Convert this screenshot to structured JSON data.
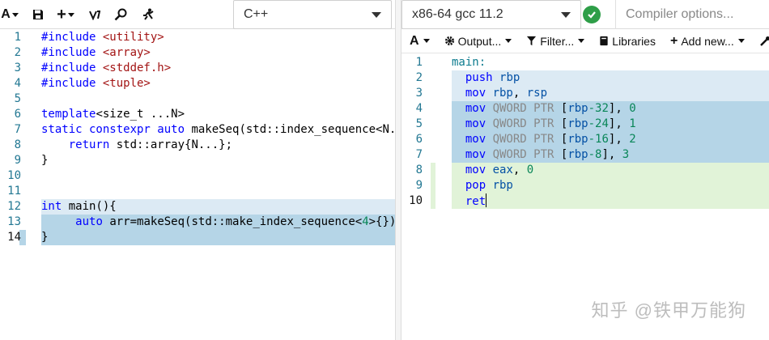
{
  "left": {
    "language": "C++",
    "toolbar": {
      "font_icon_label": "A",
      "plus_label": "+"
    },
    "lines": [
      {
        "n": "1",
        "parts": [
          [
            "kw",
            "#include "
          ],
          [
            "inc",
            "<utility>"
          ]
        ]
      },
      {
        "n": "2",
        "parts": [
          [
            "kw",
            "#include "
          ],
          [
            "inc",
            "<array>"
          ]
        ]
      },
      {
        "n": "3",
        "parts": [
          [
            "kw",
            "#include "
          ],
          [
            "inc",
            "<stddef.h>"
          ]
        ]
      },
      {
        "n": "4",
        "parts": [
          [
            "kw",
            "#include "
          ],
          [
            "inc",
            "<tuple>"
          ]
        ]
      },
      {
        "n": "5",
        "parts": []
      },
      {
        "n": "6",
        "parts": [
          [
            "kw",
            "template"
          ],
          [
            "",
            "<size_t ...N>"
          ]
        ]
      },
      {
        "n": "7",
        "parts": [
          [
            "kw",
            "static constexpr auto "
          ],
          [
            "",
            "makeSeq(std::index_sequence<N..."
          ]
        ]
      },
      {
        "n": "8",
        "parts": [
          [
            "",
            "    "
          ],
          [
            "kw",
            "return "
          ],
          [
            "",
            "std::array{N...};"
          ]
        ]
      },
      {
        "n": "9",
        "parts": [
          [
            "",
            "}"
          ]
        ]
      },
      {
        "n": "10",
        "parts": []
      },
      {
        "n": "11",
        "parts": []
      },
      {
        "n": "12",
        "parts": [
          [
            "kw",
            "int "
          ],
          [
            "",
            "main(){"
          ]
        ]
      },
      {
        "n": "13",
        "parts": [
          [
            "",
            "     "
          ],
          [
            "kw",
            "auto "
          ],
          [
            "",
            "arr=makeSeq(std::make_index_sequence<"
          ],
          [
            "num",
            "4"
          ],
          [
            "",
            ">{});"
          ]
        ]
      },
      {
        "n": "14",
        "parts": [
          [
            "",
            "}"
          ]
        ]
      }
    ]
  },
  "right": {
    "compiler": "x86-64 gcc 11.2",
    "options_placeholder": "Compiler options...",
    "subbar": {
      "font_label": "A",
      "output": "Output...",
      "filter": "Filter...",
      "libraries": "Libraries",
      "add_new": "Add new..."
    },
    "lines": [
      {
        "n": "1",
        "parts": [
          [
            "lbl",
            "main:"
          ]
        ]
      },
      {
        "n": "2",
        "parts": [
          [
            "",
            "  "
          ],
          [
            "kw",
            "push "
          ],
          [
            "reg",
            "rbp"
          ]
        ]
      },
      {
        "n": "3",
        "parts": [
          [
            "",
            "  "
          ],
          [
            "kw",
            "mov "
          ],
          [
            "reg",
            "rbp"
          ],
          [
            "",
            ", "
          ],
          [
            "reg",
            "rsp"
          ]
        ]
      },
      {
        "n": "4",
        "parts": [
          [
            "",
            "  "
          ],
          [
            "kw",
            "mov "
          ],
          [
            "dim",
            "QWORD PTR "
          ],
          [
            "",
            "["
          ],
          [
            "reg",
            "rbp"
          ],
          [
            "num",
            "-32"
          ],
          [
            "",
            "], "
          ],
          [
            "num",
            "0"
          ]
        ]
      },
      {
        "n": "5",
        "parts": [
          [
            "",
            "  "
          ],
          [
            "kw",
            "mov "
          ],
          [
            "dim",
            "QWORD PTR "
          ],
          [
            "",
            "["
          ],
          [
            "reg",
            "rbp"
          ],
          [
            "num",
            "-24"
          ],
          [
            "",
            "], "
          ],
          [
            "num",
            "1"
          ]
        ]
      },
      {
        "n": "6",
        "parts": [
          [
            "",
            "  "
          ],
          [
            "kw",
            "mov "
          ],
          [
            "dim",
            "QWORD PTR "
          ],
          [
            "",
            "["
          ],
          [
            "reg",
            "rbp"
          ],
          [
            "num",
            "-16"
          ],
          [
            "",
            "], "
          ],
          [
            "num",
            "2"
          ]
        ]
      },
      {
        "n": "7",
        "parts": [
          [
            "",
            "  "
          ],
          [
            "kw",
            "mov "
          ],
          [
            "dim",
            "QWORD PTR "
          ],
          [
            "",
            "["
          ],
          [
            "reg",
            "rbp"
          ],
          [
            "num",
            "-8"
          ],
          [
            "",
            "], "
          ],
          [
            "num",
            "3"
          ]
        ]
      },
      {
        "n": "8",
        "parts": [
          [
            "",
            "  "
          ],
          [
            "kw",
            "mov "
          ],
          [
            "reg",
            "eax"
          ],
          [
            "",
            ", "
          ],
          [
            "num",
            "0"
          ]
        ]
      },
      {
        "n": "9",
        "parts": [
          [
            "",
            "  "
          ],
          [
            "kw",
            "pop "
          ],
          [
            "reg",
            "rbp"
          ]
        ]
      },
      {
        "n": "10",
        "parts": [
          [
            "",
            "  "
          ],
          [
            "kw",
            "ret"
          ]
        ]
      }
    ]
  },
  "watermark": "知乎 @铁甲万能狗"
}
